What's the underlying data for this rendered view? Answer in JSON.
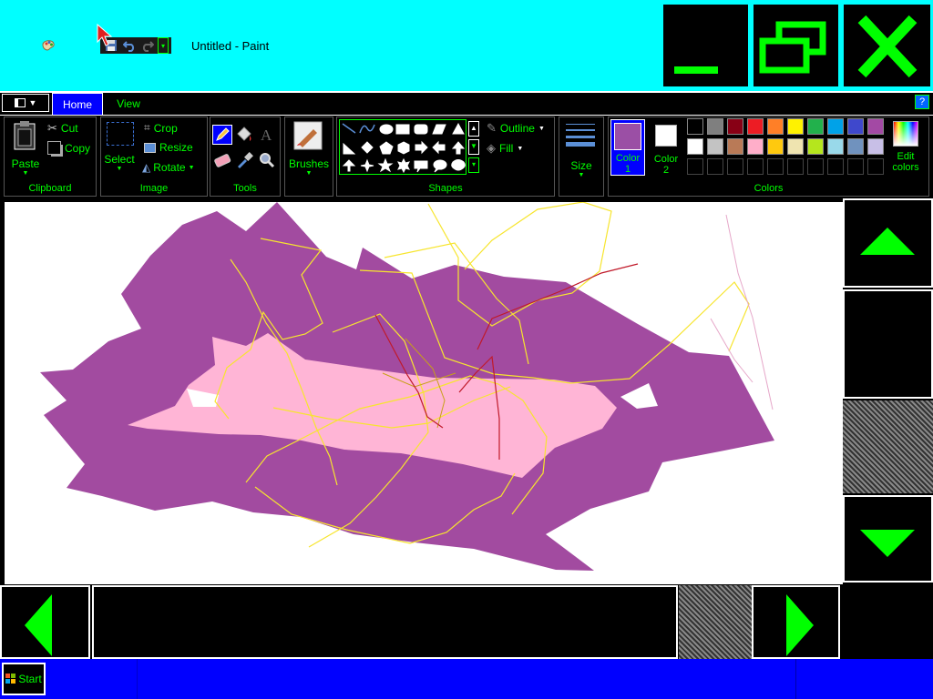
{
  "window": {
    "title": "Untitled - Paint"
  },
  "quick_access": {
    "items": [
      "save-icon",
      "undo-icon",
      "redo-icon",
      "customize-icon"
    ]
  },
  "ribbon": {
    "file_menu_icon": "menu-icon",
    "tabs": [
      {
        "label": "Home",
        "active": true
      },
      {
        "label": "View",
        "active": false
      }
    ],
    "groups": {
      "clipboard": {
        "label": "Clipboard",
        "paste": "Paste",
        "cut": "Cut",
        "copy": "Copy"
      },
      "image": {
        "label": "Image",
        "select": "Select",
        "crop": "Crop",
        "resize": "Resize",
        "rotate": "Rotate"
      },
      "tools": {
        "label": "Tools"
      },
      "brushes": {
        "label": "Brushes"
      },
      "shapes": {
        "label": "Shapes",
        "outline": "Outline",
        "fill": "Fill"
      },
      "size": {
        "label": "Size"
      },
      "colors": {
        "label": "Colors",
        "color1": "Color\n1",
        "color2": "Color\n2",
        "color1_value": "#9b4fa5",
        "color2_value": "#ffffff",
        "edit": "Edit\ncolors",
        "palette_row1": [
          "#000000",
          "#7f7f7f",
          "#880015",
          "#ed1c24",
          "#ff7f27",
          "#fff200",
          "#22b14c",
          "#00a2e8",
          "#3f48cc",
          "#a349a4"
        ],
        "palette_row2": [
          "#ffffff",
          "#c3c3c3",
          "#b97a57",
          "#ffaec9",
          "#ffc90e",
          "#efe4b0",
          "#b5e61d",
          "#99d9ea",
          "#7092be",
          "#c8bfe7"
        ]
      }
    }
  },
  "taskbar": {
    "start_label": "Start"
  },
  "colors": {
    "titlebar": "#00ffff",
    "accent": "#00ff00",
    "taskbar": "#0000ff"
  }
}
